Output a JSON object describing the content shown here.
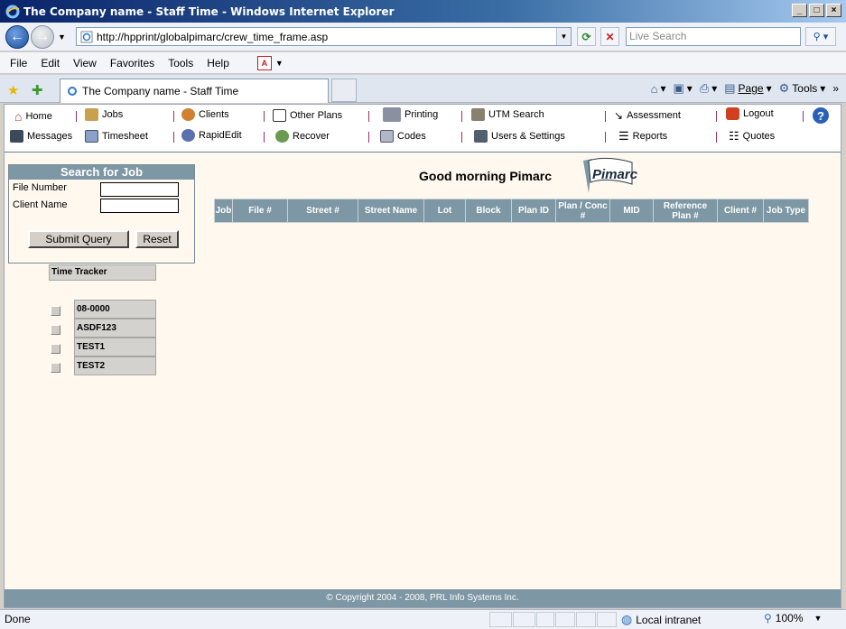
{
  "window": {
    "title": "The Company name - Staff Time - Windows Internet Explorer",
    "buttons": [
      "_",
      "□",
      "×"
    ]
  },
  "address": {
    "url": "http://hpprint/globalpimarc/crew_time_frame.asp",
    "search_placeholder": "Live Search"
  },
  "menu": [
    "File",
    "Edit",
    "View",
    "Favorites",
    "Tools",
    "Help"
  ],
  "tab": {
    "title": "The Company name - Staff Time"
  },
  "commandbar": {
    "page": "Page",
    "tools": "Tools"
  },
  "toolbar": {
    "home": "Home",
    "messages": "Messages",
    "jobs": "Jobs",
    "timesheet": "Timesheet",
    "clients": "Clients",
    "rapidedit": "RapidEdit",
    "other_plans": "Other Plans",
    "recover": "Recover",
    "printing": "Printing",
    "codes": "Codes",
    "utm_search": "UTM Search",
    "users_settings": "Users & Settings",
    "assessment": "Assessment",
    "reports": "Reports",
    "logout": "Logout",
    "quotes": "Quotes"
  },
  "search_panel": {
    "title": "Search for Job",
    "file_number_label": "File Number",
    "client_name_label": "Client Name",
    "submit": "Submit Query",
    "reset": "Reset"
  },
  "time_tracker": {
    "title": "Time Tracker",
    "items": [
      "08-0000",
      "ASDF123",
      "TEST1",
      "TEST2"
    ]
  },
  "greeting": "Good morning Pimarc",
  "logo_text": "Pimarc",
  "table": {
    "columns": [
      "Job",
      "File #",
      "Street #",
      "Street Name",
      "Lot",
      "Block",
      "Plan ID",
      "Plan / Conc #",
      "MID",
      "Reference Plan #",
      "Client #",
      "Job Type"
    ]
  },
  "footer": "© Copyright 2004 - 2008, PRL Info Systems Inc.",
  "status": {
    "text": "Done",
    "zone": "Local intranet",
    "zoom": "100%"
  }
}
